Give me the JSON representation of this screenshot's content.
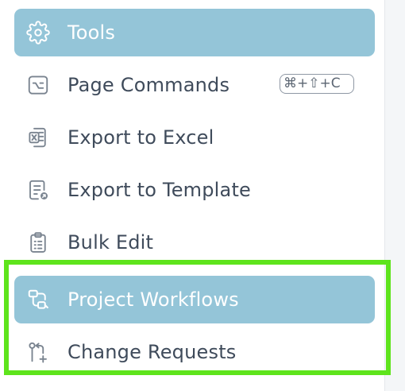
{
  "menu": {
    "items": [
      {
        "label": "Tools",
        "icon": "gear-icon",
        "active": true
      },
      {
        "label": "Page Commands",
        "icon": "terminal-icon",
        "shortcut": "⌘+⇧+C"
      },
      {
        "label": "Export to Excel",
        "icon": "excel-icon"
      },
      {
        "label": "Export to Template",
        "icon": "template-export-icon"
      },
      {
        "label": "Bulk Edit",
        "icon": "clipboard-list-icon"
      },
      {
        "label": "Project Workflows",
        "icon": "workflow-icon",
        "active": true
      },
      {
        "label": "Change Requests",
        "icon": "git-pull-request-icon"
      }
    ]
  },
  "colors": {
    "active_background": "#94c5d8",
    "active_text": "#ffffff",
    "text": "#3f4b5b",
    "highlight_border": "#5ee41c"
  }
}
